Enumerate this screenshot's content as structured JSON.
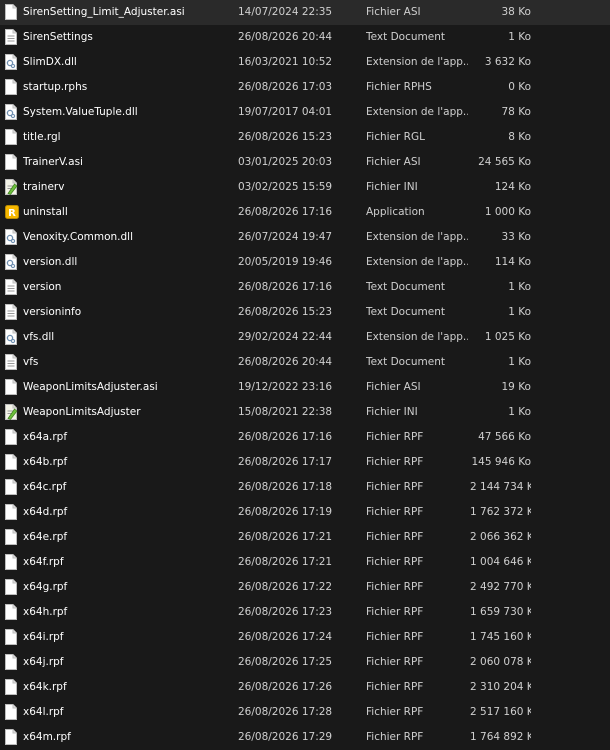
{
  "files": [
    {
      "name": "SirenSetting_Limit_Adjuster.asi",
      "date": "14/07/2024 22:35",
      "type": "Fichier ASI",
      "size": "38 Ko",
      "icon": "file-icon"
    },
    {
      "name": "SirenSettings",
      "date": "26/08/2026 20:44",
      "type": "Text Document",
      "size": "1 Ko",
      "icon": "text-document-icon"
    },
    {
      "name": "SlimDX.dll",
      "date": "16/03/2021 10:52",
      "type": "Extension de l'app...",
      "size": "3 632 Ko",
      "icon": "dll-icon"
    },
    {
      "name": "startup.rphs",
      "date": "26/08/2026 17:03",
      "type": "Fichier RPHS",
      "size": "0 Ko",
      "icon": "file-icon"
    },
    {
      "name": "System.ValueTuple.dll",
      "date": "19/07/2017 04:01",
      "type": "Extension de l'app...",
      "size": "78 Ko",
      "icon": "dll-icon"
    },
    {
      "name": "title.rgl",
      "date": "26/08/2026 15:23",
      "type": "Fichier RGL",
      "size": "8 Ko",
      "icon": "file-icon"
    },
    {
      "name": "TrainerV.asi",
      "date": "03/01/2025 20:03",
      "type": "Fichier ASI",
      "size": "24 565 Ko",
      "icon": "file-icon"
    },
    {
      "name": "trainerv",
      "date": "03/02/2025 15:59",
      "type": "Fichier INI",
      "size": "124 Ko",
      "icon": "ini-settings-icon"
    },
    {
      "name": "uninstall",
      "date": "26/08/2026 17:16",
      "type": "Application",
      "size": "1 000 Ko",
      "icon": "rockstar-app-icon"
    },
    {
      "name": "Venoxity.Common.dll",
      "date": "26/07/2024 19:47",
      "type": "Extension de l'app...",
      "size": "33 Ko",
      "icon": "dll-icon"
    },
    {
      "name": "version.dll",
      "date": "20/05/2019 19:46",
      "type": "Extension de l'app...",
      "size": "114 Ko",
      "icon": "dll-icon"
    },
    {
      "name": "version",
      "date": "26/08/2026 17:16",
      "type": "Text Document",
      "size": "1 Ko",
      "icon": "text-document-icon"
    },
    {
      "name": "versioninfo",
      "date": "26/08/2026 15:23",
      "type": "Text Document",
      "size": "1 Ko",
      "icon": "text-document-icon"
    },
    {
      "name": "vfs.dll",
      "date": "29/02/2024 22:44",
      "type": "Extension de l'app...",
      "size": "1 025 Ko",
      "icon": "dll-icon"
    },
    {
      "name": "vfs",
      "date": "26/08/2026 20:44",
      "type": "Text Document",
      "size": "1 Ko",
      "icon": "text-document-icon"
    },
    {
      "name": "WeaponLimitsAdjuster.asi",
      "date": "19/12/2022 23:16",
      "type": "Fichier ASI",
      "size": "19 Ko",
      "icon": "file-icon"
    },
    {
      "name": "WeaponLimitsAdjuster",
      "date": "15/08/2021 22:38",
      "type": "Fichier INI",
      "size": "1 Ko",
      "icon": "ini-settings-icon"
    },
    {
      "name": "x64a.rpf",
      "date": "26/08/2026 17:16",
      "type": "Fichier RPF",
      "size": "47 566 Ko",
      "icon": "file-icon"
    },
    {
      "name": "x64b.rpf",
      "date": "26/08/2026 17:17",
      "type": "Fichier RPF",
      "size": "145 946 Ko",
      "icon": "file-icon"
    },
    {
      "name": "x64c.rpf",
      "date": "26/08/2026 17:18",
      "type": "Fichier RPF",
      "size": "2 144 734 Ko",
      "icon": "file-icon"
    },
    {
      "name": "x64d.rpf",
      "date": "26/08/2026 17:19",
      "type": "Fichier RPF",
      "size": "1 762 372 Ko",
      "icon": "file-icon"
    },
    {
      "name": "x64e.rpf",
      "date": "26/08/2026 17:21",
      "type": "Fichier RPF",
      "size": "2 066 362 Ko",
      "icon": "file-icon"
    },
    {
      "name": "x64f.rpf",
      "date": "26/08/2026 17:21",
      "type": "Fichier RPF",
      "size": "1 004 646 Ko",
      "icon": "file-icon"
    },
    {
      "name": "x64g.rpf",
      "date": "26/08/2026 17:22",
      "type": "Fichier RPF",
      "size": "2 492 770 Ko",
      "icon": "file-icon"
    },
    {
      "name": "x64h.rpf",
      "date": "26/08/2026 17:23",
      "type": "Fichier RPF",
      "size": "1 659 730 Ko",
      "icon": "file-icon"
    },
    {
      "name": "x64i.rpf",
      "date": "26/08/2026 17:24",
      "type": "Fichier RPF",
      "size": "1 745 160 Ko",
      "icon": "file-icon"
    },
    {
      "name": "x64j.rpf",
      "date": "26/08/2026 17:25",
      "type": "Fichier RPF",
      "size": "2 060 078 Ko",
      "icon": "file-icon"
    },
    {
      "name": "x64k.rpf",
      "date": "26/08/2026 17:26",
      "type": "Fichier RPF",
      "size": "2 310 204 Ko",
      "icon": "file-icon"
    },
    {
      "name": "x64l.rpf",
      "date": "26/08/2026 17:28",
      "type": "Fichier RPF",
      "size": "2 517 160 Ko",
      "icon": "file-icon"
    },
    {
      "name": "x64m.rpf",
      "date": "26/08/2026 17:29",
      "type": "Fichier RPF",
      "size": "1 764 892 Ko",
      "icon": "file-icon"
    }
  ],
  "colors": {
    "background": "#191919",
    "text_primary": "#ffffff",
    "text_secondary": "#cfcfcf",
    "rockstar_yellow": "#f5b700"
  }
}
